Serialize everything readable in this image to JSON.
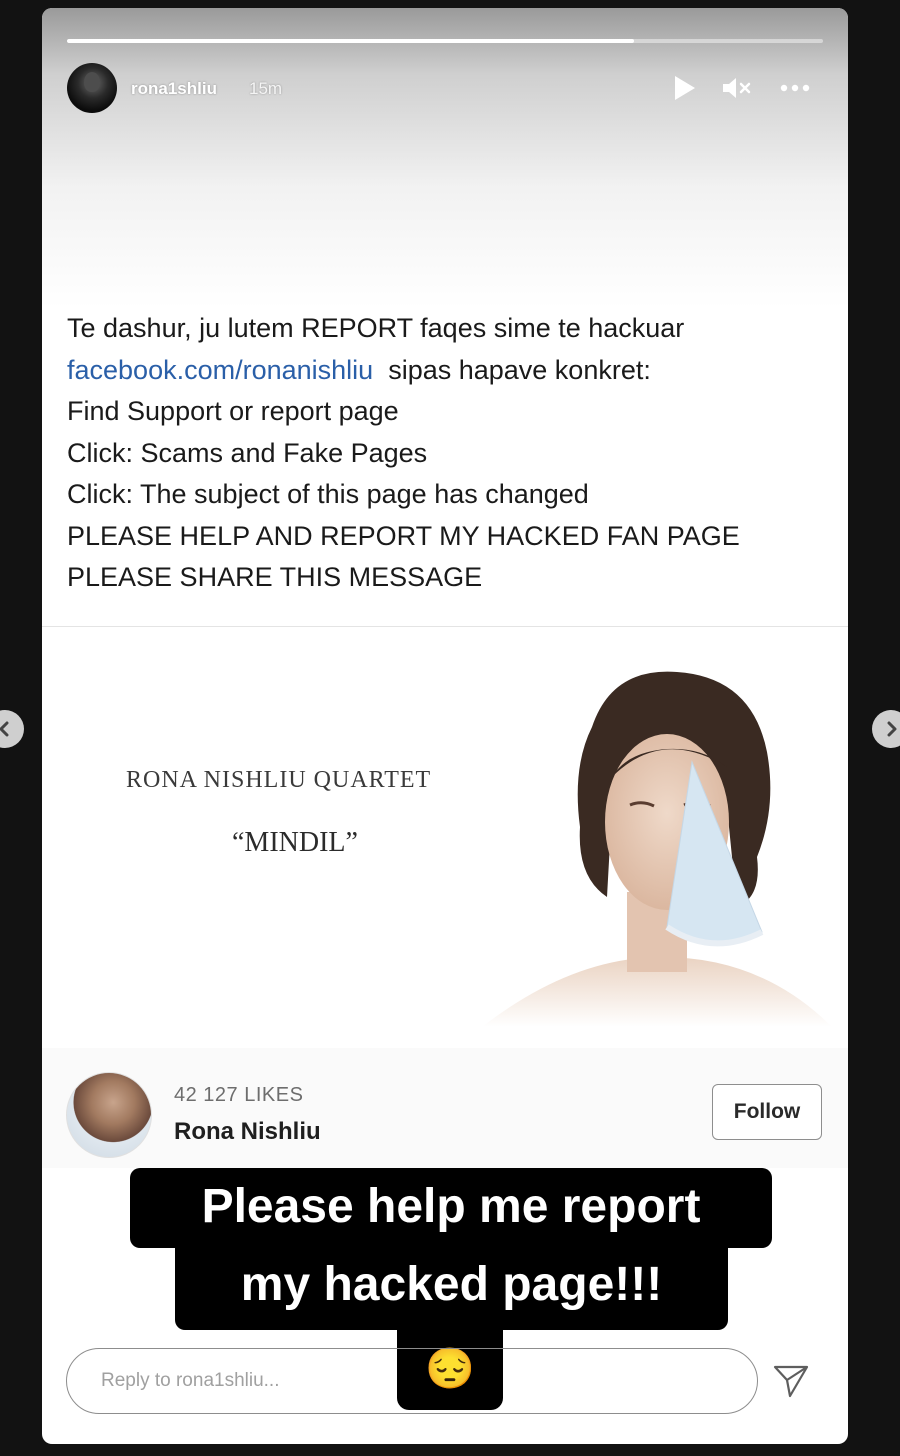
{
  "story": {
    "progress_fraction": 0.75,
    "username": "rona1shliu",
    "time_ago": "15m"
  },
  "message": {
    "line1": "Te dashur, ju lutem REPORT faqes sime te hackuar",
    "link": "facebook.com/ronanishliu",
    "line2_rest": "  sipas hapave konkret:",
    "line3": "Find Support or report page",
    "line4": "Click: Scams and Fake Pages",
    "line5": "Click: The subject of this page has changed",
    "line6": "PLEASE HELP AND REPORT MY HACKED FAN PAGE",
    "line7": "PLEASE SHARE THIS MESSAGE"
  },
  "cover": {
    "band": "RONA NISHLIU QUARTET",
    "album": "“MINDIL”"
  },
  "page": {
    "likes": "42 127 LIKES",
    "name": "Rona Nishliu",
    "follow_label": "Follow"
  },
  "caption": {
    "line1": "Please help me report",
    "line2": "my hacked page!!!",
    "emoji": "😔"
  },
  "reply": {
    "placeholder": "Reply to rona1shliu..."
  },
  "icons": {
    "play": "play-icon",
    "mute": "speaker-muted-icon",
    "more": "more-dots-icon",
    "send": "send-paper-plane-icon",
    "prev": "chevron-left-icon",
    "next": "chevron-right-icon"
  }
}
